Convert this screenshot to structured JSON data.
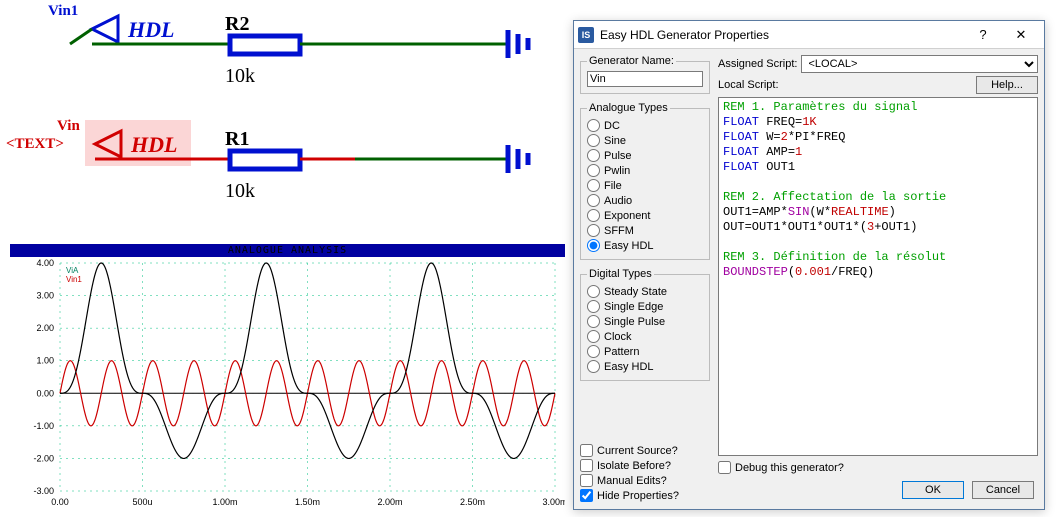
{
  "schematic": {
    "source1": {
      "label": "Vin1",
      "tech": "HDL"
    },
    "r2": {
      "ref": "R2",
      "value": "10k"
    },
    "source2": {
      "label": "Vin",
      "tech": "HDL",
      "placeholder": "<TEXT>"
    },
    "r1": {
      "ref": "R1",
      "value": "10k"
    }
  },
  "analysis": {
    "title": "ANALOGUE ANALYSIS",
    "trace1": "ViA",
    "trace2": "Vin1",
    "y_ticks": [
      "4.00",
      "3.00",
      "2.00",
      "1.00",
      "0.00",
      "-1.00",
      "-2.00",
      "-3.00"
    ],
    "x_ticks": [
      "0.00",
      "500u",
      "1.00m",
      "1.50m",
      "2.00m",
      "2.50m",
      "3.00m"
    ]
  },
  "dialog": {
    "title": "Easy HDL Generator Properties",
    "gen_name_label": "Generator Name:",
    "gen_name_value": "Vin",
    "analogue_legend": "Analogue Types",
    "analogue": [
      "DC",
      "Sine",
      "Pulse",
      "Pwlin",
      "File",
      "Audio",
      "Exponent",
      "SFFM",
      "Easy HDL"
    ],
    "analogue_selected": "Easy HDL",
    "digital_legend": "Digital Types",
    "digital": [
      "Steady State",
      "Single Edge",
      "Single Pulse",
      "Clock",
      "Pattern",
      "Easy HDL"
    ],
    "checks": [
      {
        "label": "Current Source?",
        "checked": false
      },
      {
        "label": "Isolate Before?",
        "checked": false
      },
      {
        "label": "Manual Edits?",
        "checked": false
      },
      {
        "label": "Hide Properties?",
        "checked": true
      }
    ],
    "assigned_label": "Assigned Script:",
    "assigned_value": "<LOCAL>",
    "local_label": "Local Script:",
    "help": "Help...",
    "debug": "Debug this generator?",
    "ok": "OK",
    "cancel": "Cancel",
    "code_tokens": [
      [
        [
          "cmt",
          "REM 1. Paramètres du signal"
        ]
      ],
      [
        [
          "kw",
          "FLOAT"
        ],
        [
          "",
          " FREQ="
        ],
        [
          "num",
          "1K"
        ]
      ],
      [
        [
          "kw",
          "FLOAT"
        ],
        [
          "",
          " W="
        ],
        [
          "num",
          "2"
        ],
        [
          "",
          "*PI*FREQ"
        ]
      ],
      [
        [
          "kw",
          "FLOAT"
        ],
        [
          "",
          " AMP="
        ],
        [
          "num",
          "1"
        ]
      ],
      [
        [
          "kw",
          "FLOAT"
        ],
        [
          "",
          " OUT1"
        ]
      ],
      [],
      [
        [
          "cmt",
          "REM 2. Affectation de la sortie"
        ]
      ],
      [
        [
          "",
          "OUT1=AMP*"
        ],
        [
          "fn",
          "SIN"
        ],
        [
          "",
          "(W*"
        ],
        [
          "num",
          "REALTIME"
        ],
        [
          "",
          ")"
        ]
      ],
      [
        [
          "",
          "OUT=OUT1*OUT1*OUT1*("
        ],
        [
          "num",
          "3"
        ],
        [
          "",
          "+OUT1)"
        ]
      ],
      [],
      [
        [
          "cmt",
          "REM 3. Définition de la résolut"
        ]
      ],
      [
        [
          "fn",
          "BOUNDSTEP"
        ],
        [
          "",
          "("
        ],
        [
          "num",
          "0.001"
        ],
        [
          "",
          "/FREQ)"
        ]
      ]
    ]
  },
  "chart_data": {
    "type": "line",
    "title": "ANALOGUE ANALYSIS",
    "xlabel": "",
    "ylabel": "",
    "xlim": [
      0,
      0.003
    ],
    "ylim": [
      -3,
      4
    ],
    "series": [
      {
        "name": "Vin1",
        "color": "#cc0000",
        "freq_hz": 4000,
        "amp": 1,
        "note": "sine at 4 kHz, 12 cycles visible"
      },
      {
        "name": "ViA",
        "color": "#000000",
        "freq_hz": 1000,
        "amp": 4,
        "note": "out1^3*(3+out1) with out1=sin(2π·1k·t), peaks ~4 / troughs ~-2"
      }
    ]
  }
}
